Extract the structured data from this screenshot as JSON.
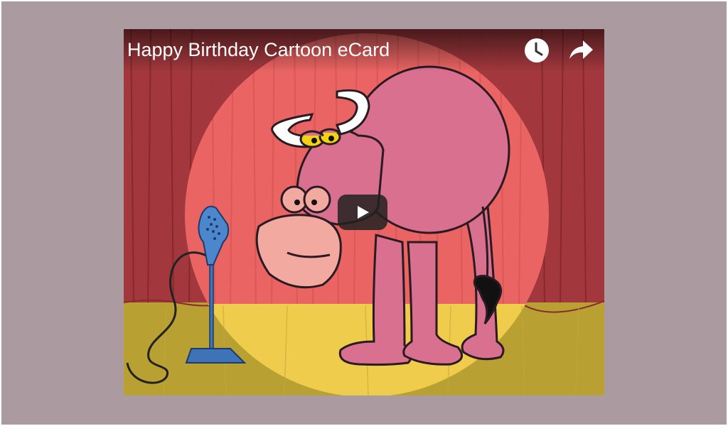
{
  "video": {
    "title": "Happy Birthday Cartoon eCard",
    "controls": {
      "watch_later_icon": "clock-icon",
      "share_icon": "share-arrow-icon",
      "play_icon": "play-icon"
    }
  },
  "colors": {
    "page_background": "#ab9aa0",
    "curtain": "#a2383d",
    "spotlight": "#e96462",
    "stage_floor": "#b8a033",
    "spotlight_floor": "#f0cc4c",
    "bull": "#d9708f",
    "microphone": "#3f73b8",
    "play_button": "#212121"
  }
}
